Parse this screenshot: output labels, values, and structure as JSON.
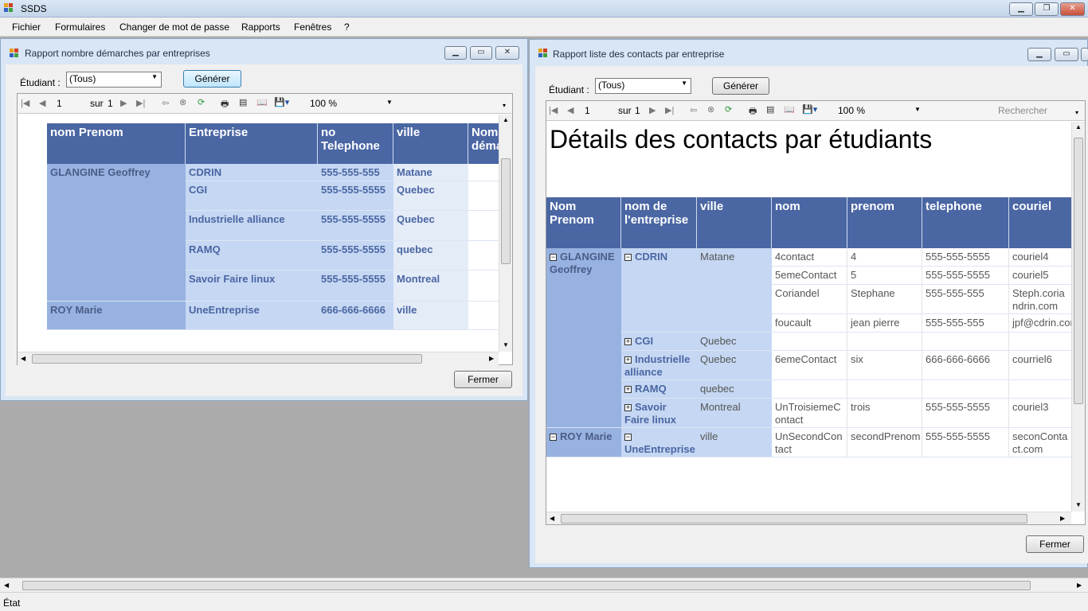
{
  "app": {
    "title": "SSDS"
  },
  "menu": [
    "Fichier",
    "Formulaires",
    "Changer de mot de passe",
    "Rapports",
    "Fenêtres",
    "?"
  ],
  "left_window": {
    "title": "Rapport nombre démarches par entreprises",
    "etudiant_label": "Étudiant :",
    "etudiant_value": "(Tous)",
    "generate": "Générer",
    "close": "Fermer",
    "page": "1",
    "of": "sur",
    "total": "1",
    "zoom": "100 %",
    "headers": [
      "nom Prenom",
      "Entreprise",
      "no Telephone",
      "ville",
      "Nom déma"
    ],
    "groups": [
      {
        "name": "GLANGINE Geoffrey",
        "rows": [
          {
            "entreprise": "CDRIN",
            "tel": "555-555-555",
            "ville": "Matane"
          },
          {
            "entreprise": "CGI",
            "tel": "555-555-5555",
            "ville": "Quebec"
          },
          {
            "entreprise": "Industrielle alliance",
            "tel": "555-555-5555",
            "ville": "Quebec"
          },
          {
            "entreprise": "RAMQ",
            "tel": "555-555-5555",
            "ville": "quebec"
          },
          {
            "entreprise": "Savoir Faire linux",
            "tel": "555-555-5555",
            "ville": "Montreal"
          }
        ]
      },
      {
        "name": "ROY Marie",
        "rows": [
          {
            "entreprise": "UneEntreprise",
            "tel": "666-666-6666",
            "ville": "ville"
          }
        ]
      }
    ]
  },
  "right_window": {
    "title": "Rapport liste des contacts par entreprise",
    "etudiant_label": "Étudiant :",
    "etudiant_value": "(Tous)",
    "generate": "Générer",
    "close": "Fermer",
    "page": "1",
    "of": "sur",
    "total": "1",
    "zoom": "100 %",
    "search": "Rechercher",
    "report_title": "Détails des contacts par étudiants",
    "headers": [
      "Nom Prenom",
      "nom de l'entreprise",
      "ville",
      "nom",
      "prenom",
      "telephone",
      "couriel"
    ],
    "students": [
      "GLANGINE Geoffrey",
      "ROY Marie"
    ],
    "companies": [
      {
        "name": "CDRIN",
        "ville": "Matane"
      },
      {
        "name": "CGI",
        "ville": "Quebec"
      },
      {
        "name": "Industrielle alliance",
        "ville": "Quebec"
      },
      {
        "name": "RAMQ",
        "ville": "quebec"
      },
      {
        "name": "Savoir Faire linux",
        "ville": "Montreal"
      },
      {
        "name": "UneEntreprise",
        "ville": "ville"
      }
    ],
    "contacts": [
      [
        "4contact",
        "4",
        "555-555-5555",
        "couriel4"
      ],
      [
        "5emeContact",
        "5",
        "555-555-5555",
        "couriel5"
      ],
      [
        "Coriandel",
        "Stephane",
        "555-555-555",
        "Steph.coriandrin.com"
      ],
      [
        "foucault",
        "jean pierre",
        "555-555-555",
        "jpf@cdrin.com"
      ],
      [
        "6emeContact",
        "six",
        "666-666-6666",
        "courriel6"
      ],
      [
        "UnTroisiemeContact",
        "trois",
        "555-555-5555",
        "couriel3"
      ],
      [
        "UnSecondContact",
        "secondPrenom",
        "555-555-5555",
        "seconContact.com"
      ]
    ]
  },
  "status": "État"
}
